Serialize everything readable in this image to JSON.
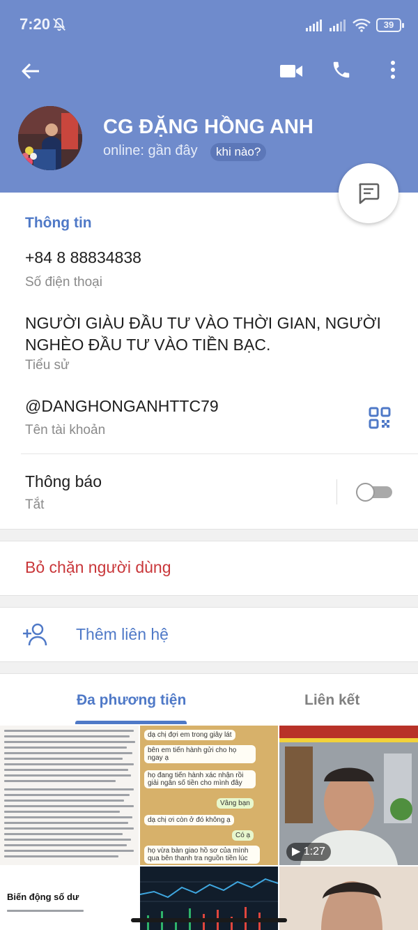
{
  "status_bar": {
    "time": "7:20",
    "battery": "39",
    "icons": [
      "bell-off-icon",
      "signal-icon",
      "signal-icon",
      "wifi-icon",
      "battery-icon"
    ]
  },
  "app_bar": {
    "icons": [
      "back-arrow-icon",
      "video-camera-icon",
      "phone-icon",
      "more-vert-icon"
    ]
  },
  "profile": {
    "name": "CG ĐẶNG HỒNG ANH",
    "status": "online: gần đây",
    "status_chip": "khi nào?"
  },
  "info": {
    "section_title": "Thông tin",
    "phone": "+84 8 88834838",
    "phone_label": "Số điện thoại",
    "bio": "NGƯỜI GIÀU ĐẦU TƯ VÀO THỜI GIAN, NGƯỜI NGHÈO ĐẦU TƯ VÀO TIỀN BẠC.",
    "bio_label": "Tiểu sử",
    "username": "@DANGHONGANHTTC79",
    "username_label": "Tên tài khoản",
    "notifications": "Thông báo",
    "notifications_state": "Tắt"
  },
  "actions": {
    "unblock": "Bỏ chặn người dùng",
    "add_contact": "Thêm liên hệ"
  },
  "tabs": {
    "media": "Đa phương tiện",
    "links": "Liên kết",
    "active": "media"
  },
  "media": {
    "chat_bubbles": [
      "dạ chị đợi em trong giây lát",
      "bên em tiến hành gửi cho họ ngay ạ",
      "họ đang tiến hành xác nhận rồi giải ngân số tiền cho mình đây",
      "Vâng bạn",
      "dạ chị ơi còn ở đó không ạ",
      "Có ạ",
      "họ vừa bàn giao hồ sơ của mình qua bên thanh tra nguồn tiền lúc"
    ],
    "video_duration": "1:27",
    "balance_caption": "Biến động số dư"
  },
  "colors": {
    "header": "#6f8bcc",
    "accent": "#4f79c7",
    "danger": "#c9373a"
  }
}
